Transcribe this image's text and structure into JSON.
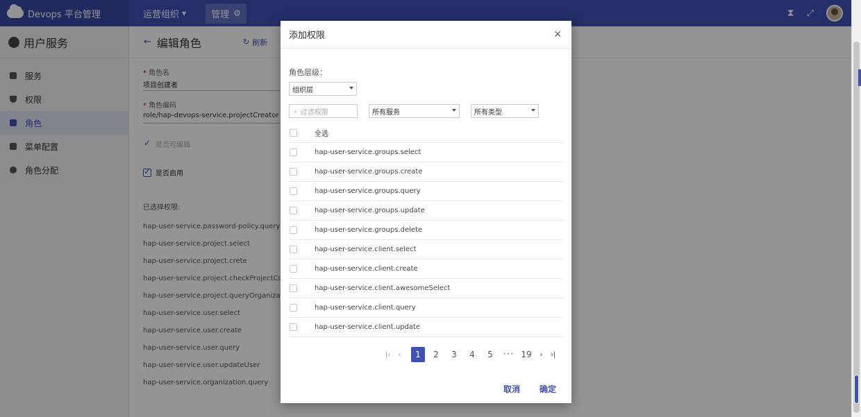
{
  "topbar": {
    "brand": "Devops 平台管理",
    "org_menu": "运营组织",
    "manage": "管理"
  },
  "sidebar": {
    "title": "用户服务",
    "items": [
      {
        "label": "服务"
      },
      {
        "label": "权限"
      },
      {
        "label": "角色"
      },
      {
        "label": "菜单配置"
      },
      {
        "label": "角色分配"
      }
    ]
  },
  "page": {
    "title": "编辑角色",
    "refresh": "刷新",
    "role_name_label": "角色名",
    "role_name_value": "项目创建者",
    "role_code_label": "角色编码",
    "role_code_value": "role/hap-devops-service.projectCreator",
    "editable_label": "是否可编辑",
    "enabled_label": "是否启用",
    "selected_title": "已选择权限:",
    "selected_perms": [
      "hap-user-service.password-policy.queryOrganization",
      "hap-user-service.project.select",
      "hap-user-service.project.crete",
      "hap-user-service.project.checkProjectCode",
      "hap-user-service.project.queryOrganizationProject",
      "hap-user-service.user.select",
      "hap-user-service.user.create",
      "hap-user-service.user.query",
      "hap-user-service.user.updateUser",
      "hap-user-service.organization.query"
    ]
  },
  "dialog": {
    "title": "添加权限",
    "level_label": "角色层级：",
    "level_value": "组织层",
    "search_placeholder": "过滤权限",
    "service_filter": "所有服务",
    "type_filter": "所有类型",
    "select_all": "全选",
    "rows": [
      "hap-user-service.groups.select",
      "hap-user-service.groups.create",
      "hap-user-service.groups.query",
      "hap-user-service.groups.update",
      "hap-user-service.groups.delete",
      "hap-user-service.client.select",
      "hap-user-service.client.create",
      "hap-user-service.client.awesomeSelect",
      "hap-user-service.client.query",
      "hap-user-service.client.update"
    ],
    "pagination": {
      "current": "1",
      "pages": [
        "2",
        "3",
        "4",
        "5"
      ],
      "ellipsis": "•••",
      "last": "19"
    },
    "cancel": "取消",
    "confirm": "确定"
  },
  "colors": {
    "primary": "#3f51b5"
  }
}
